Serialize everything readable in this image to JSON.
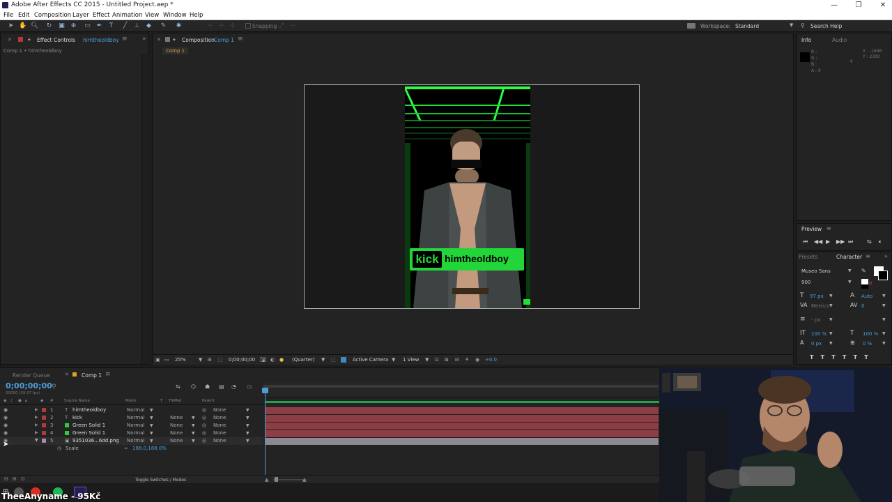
{
  "window": {
    "title": "Adobe After Effects CC 2015 - Untitled Project.aep *",
    "minimize": "—",
    "maximize": "❐",
    "close": "✕"
  },
  "menu": [
    "File",
    "Edit",
    "Composition",
    "Layer",
    "Effect",
    "Animation",
    "View",
    "Window",
    "Help"
  ],
  "toolbar": {
    "snapping": "Snapping",
    "workspace_label": "Workspace:",
    "workspace_value": "Standard",
    "search_help": "Search Help"
  },
  "effect_panel": {
    "tab_label": "Effect Controls",
    "tab_layer": "himtheoldboy",
    "breadcrumb": "Comp 1 • himtheoldboy"
  },
  "comp_panel": {
    "tab_label": "Composition",
    "tab_comp": "Comp 1",
    "subtab": "Comp 1",
    "zoom": "25%",
    "timecode": "0;00;00;00",
    "resolution": "(Quarter)",
    "camera": "Active Camera",
    "views": "1 View",
    "exposure": "+0.0"
  },
  "overlay": {
    "badge_word": "kick",
    "badge_name": "himtheoldboy"
  },
  "info_panel": {
    "tab_info": "Info",
    "tab_audio": "Audio",
    "r": "R :",
    "g": "G :",
    "b": "B :",
    "a": "A : 0",
    "x": "X : -1696",
    "y": "Y : 2300"
  },
  "preview_panel": {
    "title": "Preview"
  },
  "character_panel": {
    "tab_presets": "Presets",
    "tab_character": "Character",
    "font": "Museo Sans",
    "weight": "900",
    "size": "97 px",
    "leading": "Auto",
    "kerning": "Metrics",
    "tracking": "0",
    "stroke": "- px",
    "vscale": "100 %",
    "hscale": "100 %",
    "baseline": "0 px",
    "tsume": "0 %"
  },
  "timeline": {
    "tab_render": "Render Queue",
    "tab_comp": "Comp 1",
    "timecode": "0;00;00;00",
    "frameinfo": "00000 (29.97 fps)",
    "col_source": "Source Name",
    "col_mode": "Mode",
    "col_t": "T",
    "col_trkmat": "TrkMat",
    "col_parent": "Parent",
    "toggle_label": "Toggle Switches / Modes",
    "layers": [
      {
        "num": "1",
        "name": "himtheoldboy",
        "mode": "Normal",
        "trkmat": "",
        "parent": "None",
        "color": "#b53838"
      },
      {
        "num": "2",
        "name": "kick",
        "mode": "Normal",
        "trkmat": "None",
        "parent": "None",
        "color": "#b53838"
      },
      {
        "num": "3",
        "name": "Green Solid 1",
        "mode": "Normal",
        "trkmat": "None",
        "parent": "None",
        "color": "#b53838"
      },
      {
        "num": "4",
        "name": "Green Solid 1",
        "mode": "Normal",
        "trkmat": "None",
        "parent": "None",
        "color": "#b53838"
      },
      {
        "num": "5",
        "name": "9351036...6dd.png",
        "mode": "Normal",
        "trkmat": "None",
        "parent": "None",
        "color": "#a68ca8"
      }
    ],
    "scale_label": "Scale",
    "scale_value": "188.0,188.0%"
  },
  "taskbar": {
    "overlay_text": "TheeAnyname - 95Kč"
  },
  "colors": {
    "accent": "#4a9fd8",
    "badge_green": "#22d63a",
    "layer_red": "#b53838",
    "layer_track": "#8c3d45"
  }
}
